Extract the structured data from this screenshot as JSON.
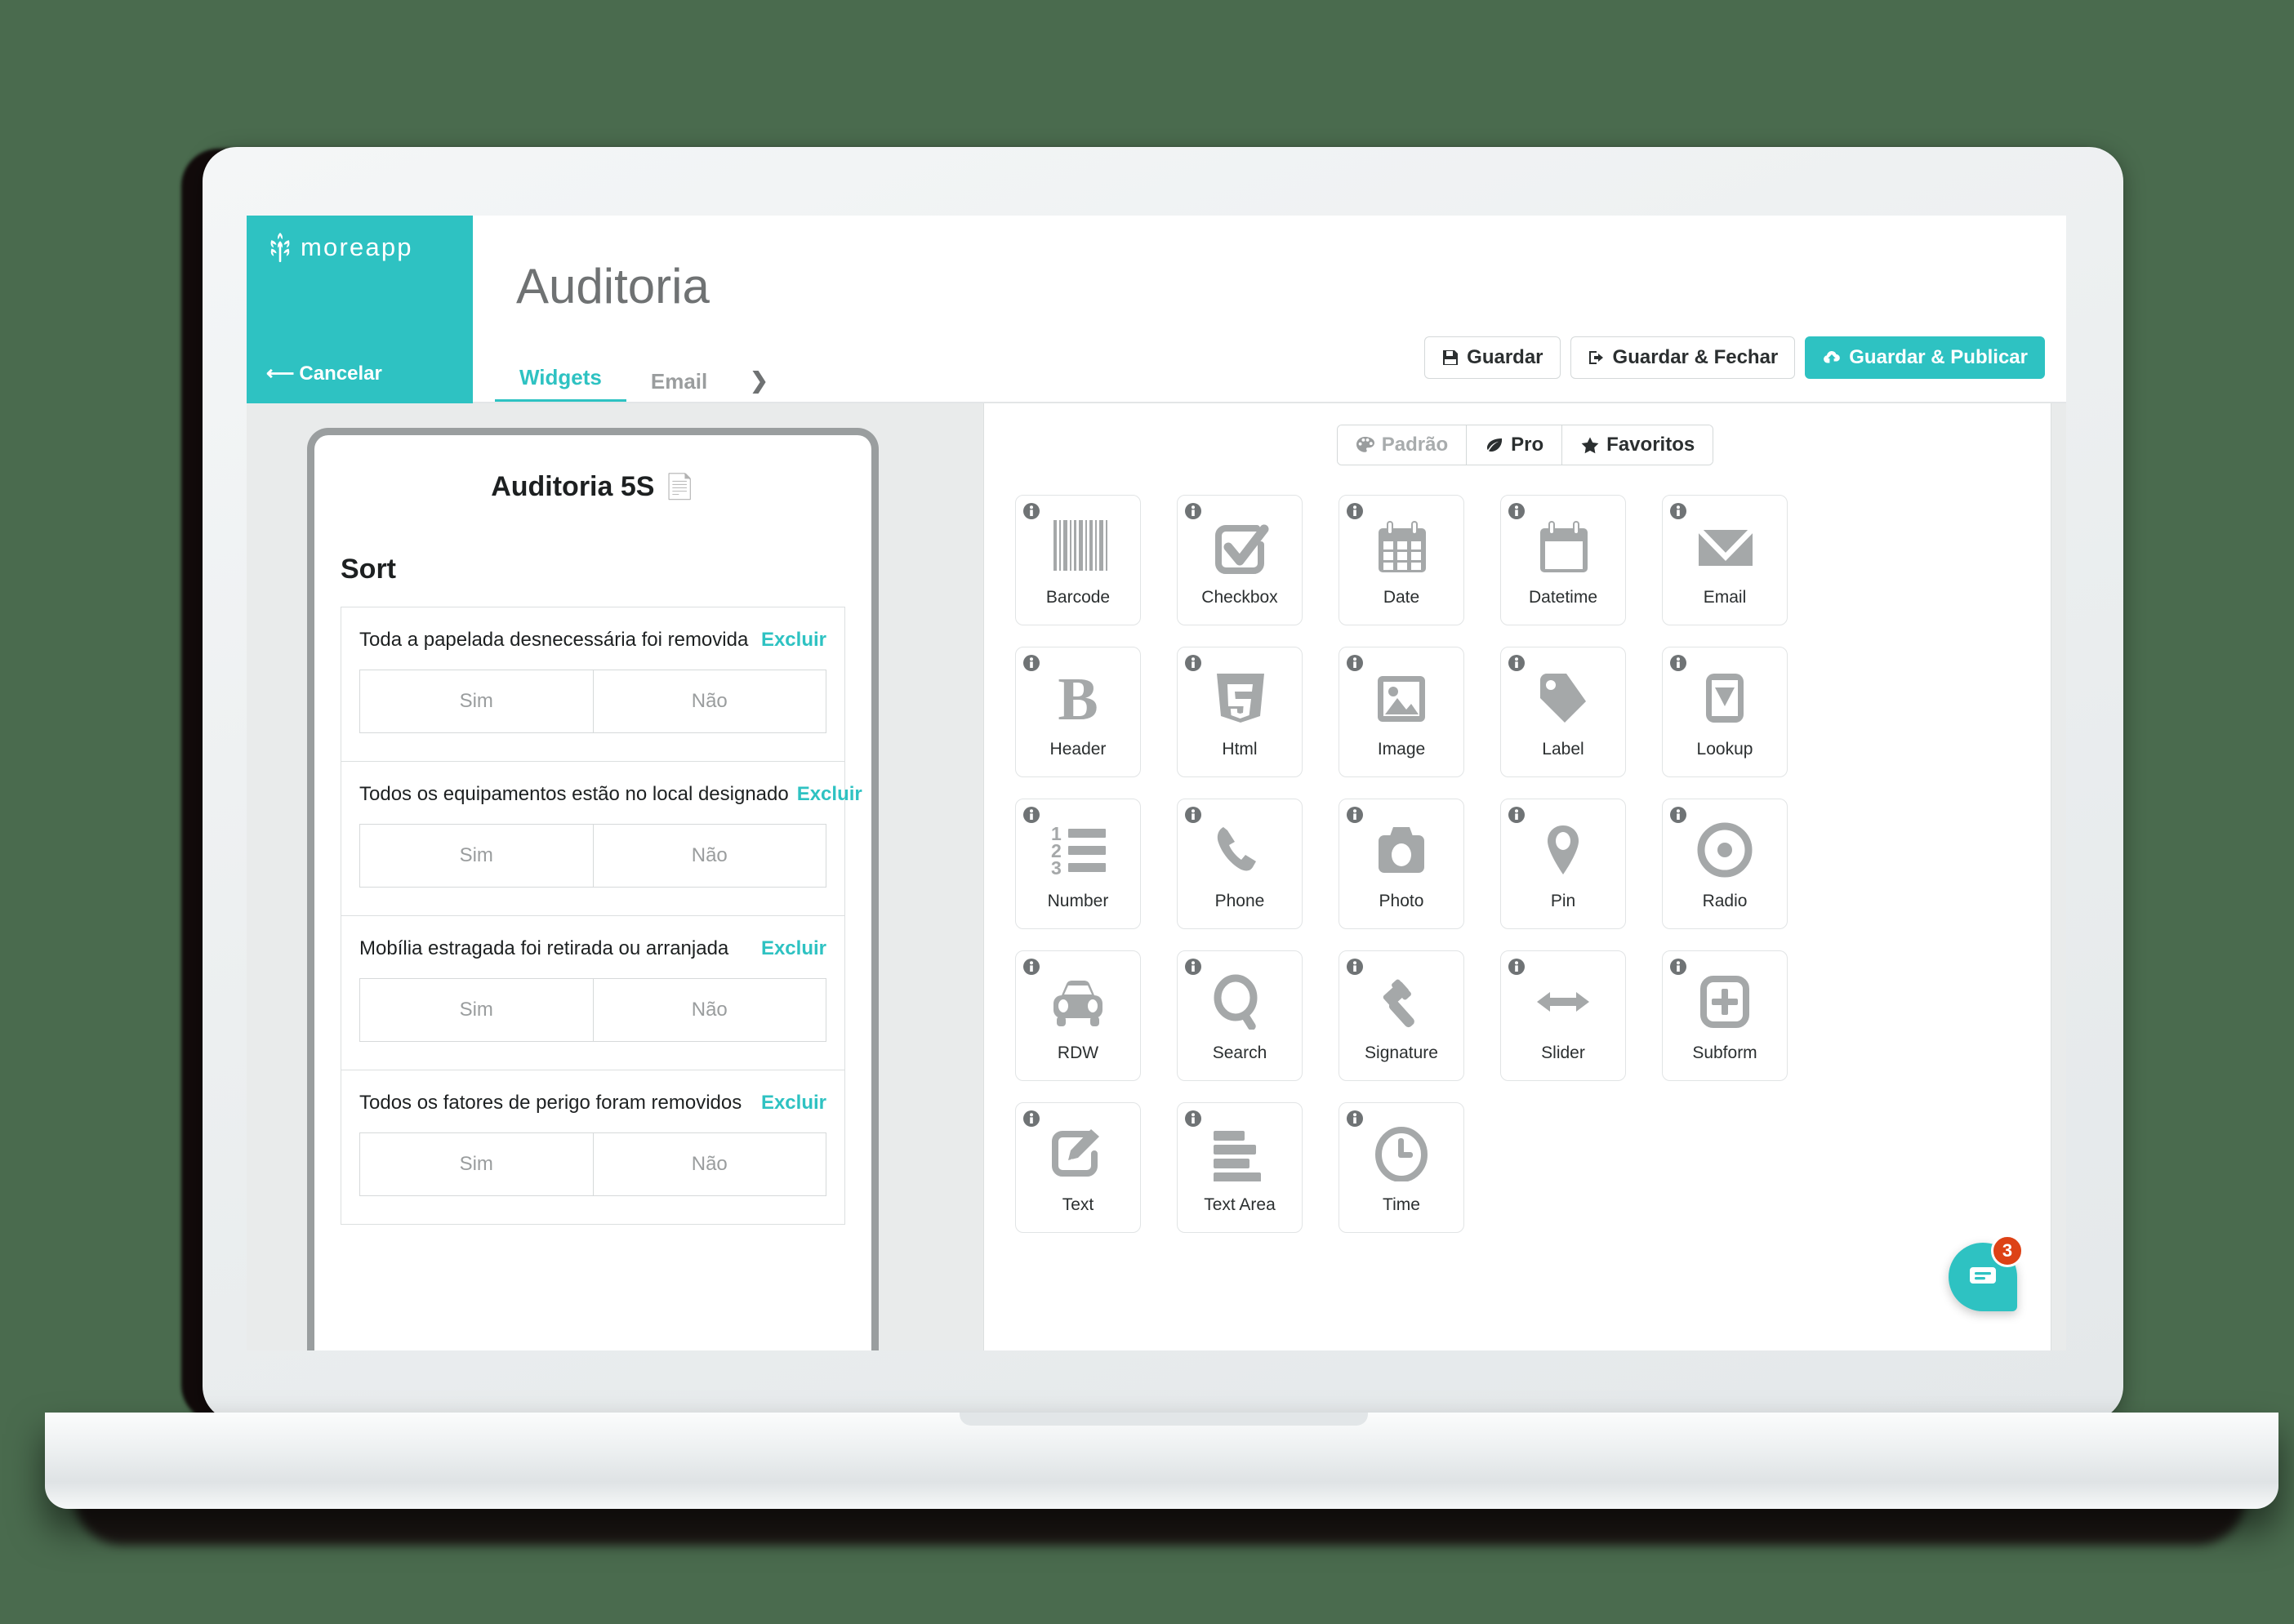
{
  "brand": {
    "name": "moreapp",
    "logo_icon": "wheat-icon",
    "cancel_label": "Cancelar",
    "cancel_icon": "arrow-left-icon",
    "color": "#2ec2c2"
  },
  "header": {
    "title": "Auditoria",
    "tabs": [
      {
        "label": "Widgets",
        "active": true
      },
      {
        "label": "Email",
        "active": false
      }
    ],
    "tab_overflow_icon": "chevron-right-icon",
    "actions": [
      {
        "label": "Guardar",
        "icon": "save-icon",
        "primary": false
      },
      {
        "label": "Guardar & Fechar",
        "icon": "sign-out-icon",
        "primary": false
      },
      {
        "label": "Guardar & Publicar",
        "icon": "cloud-upload-icon",
        "primary": true
      }
    ]
  },
  "preview": {
    "form_title": "Auditoria 5S",
    "form_title_icon": "document-icon",
    "section_title": "Sort",
    "delete_label": "Excluir",
    "yes_label": "Sim",
    "no_label": "Não",
    "questions": [
      {
        "label": "Toda a papelada desnecessária foi removida"
      },
      {
        "label": "Todos os equipamentos estão no local designado"
      },
      {
        "label": "Mobília estragada foi retirada ou arranjada"
      },
      {
        "label": "Todos os fatores de perigo foram removidos"
      }
    ]
  },
  "widget_picker": {
    "filters": [
      {
        "label": "Padrão",
        "icon": "palette-icon",
        "active": false,
        "muted": true
      },
      {
        "label": "Pro",
        "icon": "leaf-icon",
        "active": false,
        "muted": false
      },
      {
        "label": "Favoritos",
        "icon": "star-icon",
        "active": false,
        "muted": false
      }
    ],
    "info_icon": "info-icon",
    "widgets": [
      {
        "label": "Barcode",
        "icon": "barcode-icon"
      },
      {
        "label": "Checkbox",
        "icon": "checkbox-icon"
      },
      {
        "label": "Date",
        "icon": "calendar-icon"
      },
      {
        "label": "Datetime",
        "icon": "calendar-blank-icon"
      },
      {
        "label": "Email",
        "icon": "envelope-icon"
      },
      {
        "label": "Header",
        "icon": "bold-b-icon"
      },
      {
        "label": "Html",
        "icon": "html5-icon"
      },
      {
        "label": "Image",
        "icon": "image-icon"
      },
      {
        "label": "Label",
        "icon": "tag-icon"
      },
      {
        "label": "Lookup",
        "icon": "dropdown-icon"
      },
      {
        "label": "Number",
        "icon": "numbered-list-icon"
      },
      {
        "label": "Phone",
        "icon": "phone-icon"
      },
      {
        "label": "Photo",
        "icon": "camera-icon"
      },
      {
        "label": "Pin",
        "icon": "map-pin-icon"
      },
      {
        "label": "Radio",
        "icon": "radio-button-icon"
      },
      {
        "label": "RDW",
        "icon": "car-icon"
      },
      {
        "label": "Search",
        "icon": "magnifier-icon"
      },
      {
        "label": "Signature",
        "icon": "gavel-icon"
      },
      {
        "label": "Slider",
        "icon": "double-arrow-icon"
      },
      {
        "label": "Subform",
        "icon": "plus-box-icon"
      },
      {
        "label": "Text",
        "icon": "pencil-note-icon"
      },
      {
        "label": "Text Area",
        "icon": "lines-icon"
      },
      {
        "label": "Time",
        "icon": "clock-icon"
      }
    ]
  },
  "chat": {
    "icon": "chat-icon",
    "badge_count": "3"
  }
}
